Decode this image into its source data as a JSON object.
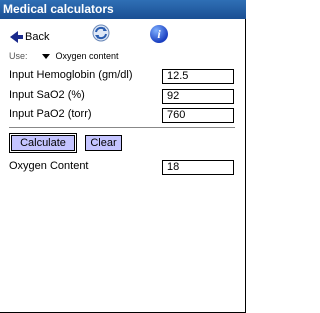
{
  "window": {
    "title": "Medical calculators"
  },
  "toolbar": {
    "back_label": "Back"
  },
  "use": {
    "label": "Use:",
    "selected": "Oxygen content"
  },
  "inputs": [
    {
      "label": "Input Hemoglobin (gm/dl)",
      "value": "12.5"
    },
    {
      "label": "Input SaO2 (%)",
      "value": "92"
    },
    {
      "label": "Input PaO2 (torr)",
      "value": "760"
    }
  ],
  "buttons": {
    "calculate": "Calculate",
    "clear": "Clear"
  },
  "result": {
    "label": "Oxygen Content",
    "value": "18"
  }
}
